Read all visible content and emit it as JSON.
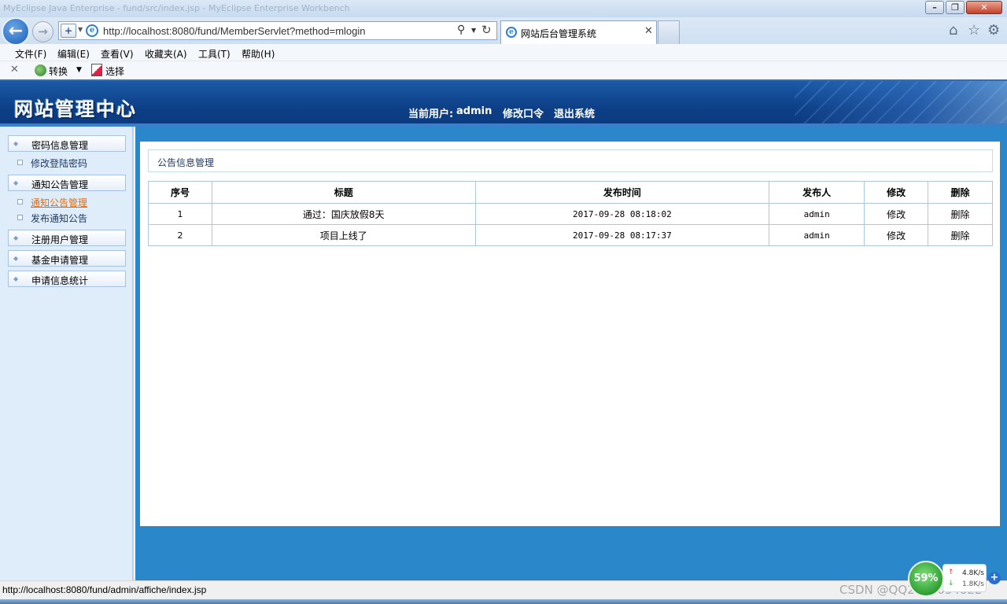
{
  "browser": {
    "window_title": "MyEclipse Java Enterprise - fund/src/index.jsp - MyEclipse Enterprise Workbench",
    "address_url": "http://localhost:8080/fund/MemberServlet?method=mlogin",
    "tab_title": "网站后台管理系统",
    "menu": [
      "文件(F)",
      "编辑(E)",
      "查看(V)",
      "收藏夹(A)",
      "工具(T)",
      "帮助(H)"
    ],
    "command_bar": {
      "convert_label": "转换",
      "select_label": "选择"
    },
    "status_text": "http://localhost:8080/fund/admin/affiche/index.jsp",
    "watermark": "CSDN @QQ2892034822"
  },
  "header": {
    "logo": "网站管理中心",
    "current_user_label": "当前用户:",
    "current_user": "admin",
    "change_password": "修改口令",
    "logout": "退出系统"
  },
  "sidebar": {
    "groups": [
      {
        "label": "密码信息管理",
        "children": [
          {
            "label": "修改登陆密码",
            "active": false
          }
        ]
      },
      {
        "label": "通知公告管理",
        "children": [
          {
            "label": "通知公告管理",
            "active": true
          },
          {
            "label": "发布通知公告",
            "active": false
          }
        ]
      },
      {
        "label": "注册用户管理",
        "children": []
      },
      {
        "label": "基金申请管理",
        "children": []
      },
      {
        "label": "申请信息统计",
        "children": []
      }
    ]
  },
  "main": {
    "panel_title": "公告信息管理",
    "table": {
      "columns": [
        "序号",
        "标题",
        "发布时间",
        "发布人",
        "修改",
        "删除"
      ],
      "rows": [
        [
          "1",
          "通过：国庆放假8天",
          "2017-09-28 08:18:02",
          "admin",
          "修改",
          "删除"
        ],
        [
          "2",
          "项目上线了",
          "2017-09-28 08:17:37",
          "admin",
          "修改",
          "删除"
        ]
      ]
    }
  },
  "netmon": {
    "percent": "59%",
    "up": "4.8K/s",
    "down": "1.8K/s"
  }
}
